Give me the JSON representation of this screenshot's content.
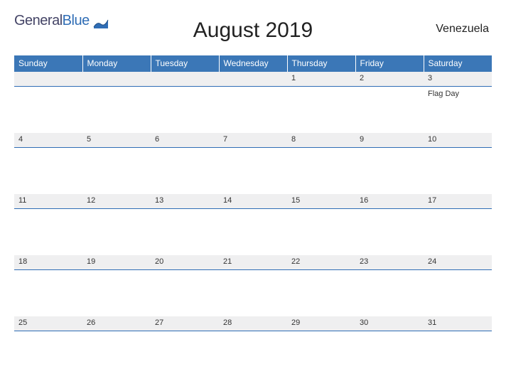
{
  "brand": {
    "word1": "General",
    "word2": "Blue"
  },
  "title": "August 2019",
  "country": "Venezuela",
  "days": [
    "Sunday",
    "Monday",
    "Tuesday",
    "Wednesday",
    "Thursday",
    "Friday",
    "Saturday"
  ],
  "weeks": [
    [
      {
        "num": "",
        "event": ""
      },
      {
        "num": "",
        "event": ""
      },
      {
        "num": "",
        "event": ""
      },
      {
        "num": "",
        "event": ""
      },
      {
        "num": "1",
        "event": ""
      },
      {
        "num": "2",
        "event": ""
      },
      {
        "num": "3",
        "event": "Flag Day"
      }
    ],
    [
      {
        "num": "4",
        "event": ""
      },
      {
        "num": "5",
        "event": ""
      },
      {
        "num": "6",
        "event": ""
      },
      {
        "num": "7",
        "event": ""
      },
      {
        "num": "8",
        "event": ""
      },
      {
        "num": "9",
        "event": ""
      },
      {
        "num": "10",
        "event": ""
      }
    ],
    [
      {
        "num": "11",
        "event": ""
      },
      {
        "num": "12",
        "event": ""
      },
      {
        "num": "13",
        "event": ""
      },
      {
        "num": "14",
        "event": ""
      },
      {
        "num": "15",
        "event": ""
      },
      {
        "num": "16",
        "event": ""
      },
      {
        "num": "17",
        "event": ""
      }
    ],
    [
      {
        "num": "18",
        "event": ""
      },
      {
        "num": "19",
        "event": ""
      },
      {
        "num": "20",
        "event": ""
      },
      {
        "num": "21",
        "event": ""
      },
      {
        "num": "22",
        "event": ""
      },
      {
        "num": "23",
        "event": ""
      },
      {
        "num": "24",
        "event": ""
      }
    ],
    [
      {
        "num": "25",
        "event": ""
      },
      {
        "num": "26",
        "event": ""
      },
      {
        "num": "27",
        "event": ""
      },
      {
        "num": "28",
        "event": ""
      },
      {
        "num": "29",
        "event": ""
      },
      {
        "num": "30",
        "event": ""
      },
      {
        "num": "31",
        "event": ""
      }
    ]
  ]
}
